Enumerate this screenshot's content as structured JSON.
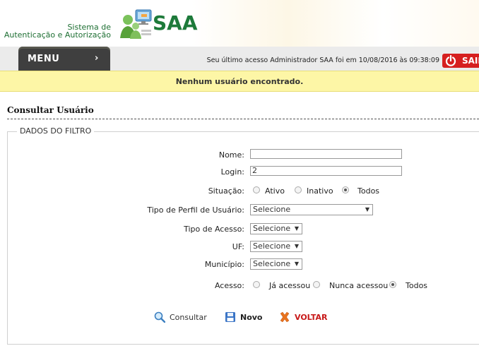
{
  "header": {
    "system_name_line1": "Sistema de",
    "system_name_line2": "Autenticação e Autorização",
    "logo_text": "SAA"
  },
  "nav": {
    "menu_label": "MENU",
    "menu_chevron": "›",
    "last_access": "Seu último acesso Administrador SAA foi em 10/08/2016 às 09:38:09",
    "logout_label": "SAIR"
  },
  "message": "Nenhum usuário encontrado.",
  "page_title": "Consultar Usuário",
  "filter": {
    "legend": "DADOS DO FILTRO",
    "nome": {
      "label": "Nome:",
      "value": ""
    },
    "login": {
      "label": "Login:",
      "value": "2"
    },
    "situacao": {
      "label": "Situação:",
      "options": [
        "Ativo",
        "Inativo",
        "Todos"
      ],
      "selected": "Todos"
    },
    "tipo_perfil": {
      "label": "Tipo de Perfil de Usuário:",
      "value": "Selecione"
    },
    "tipo_acesso": {
      "label": "Tipo de Acesso:",
      "value": "Selecione"
    },
    "uf": {
      "label": "UF:",
      "value": "Selecione"
    },
    "municipio": {
      "label": "Município:",
      "value": "Selecione"
    },
    "acesso": {
      "label": "Acesso:",
      "options": [
        "Já acessou",
        "Nunca acessou",
        "Todos"
      ],
      "selected": "Todos"
    }
  },
  "actions": {
    "consultar": "Consultar",
    "novo": "Novo",
    "voltar": "VOLTAR"
  },
  "icons": {
    "logo": "users-computer-icon",
    "logout": "power-icon",
    "consultar": "magnifier-icon",
    "novo": "floppy-disk-icon",
    "voltar": "x-cross-icon"
  },
  "colors": {
    "brand_green": "#1d7a3a",
    "menu_dark": "#3f3f3f",
    "logout_red": "#d61f1f",
    "message_yellow": "#fdf6a6",
    "voltar_red": "#c81919"
  }
}
